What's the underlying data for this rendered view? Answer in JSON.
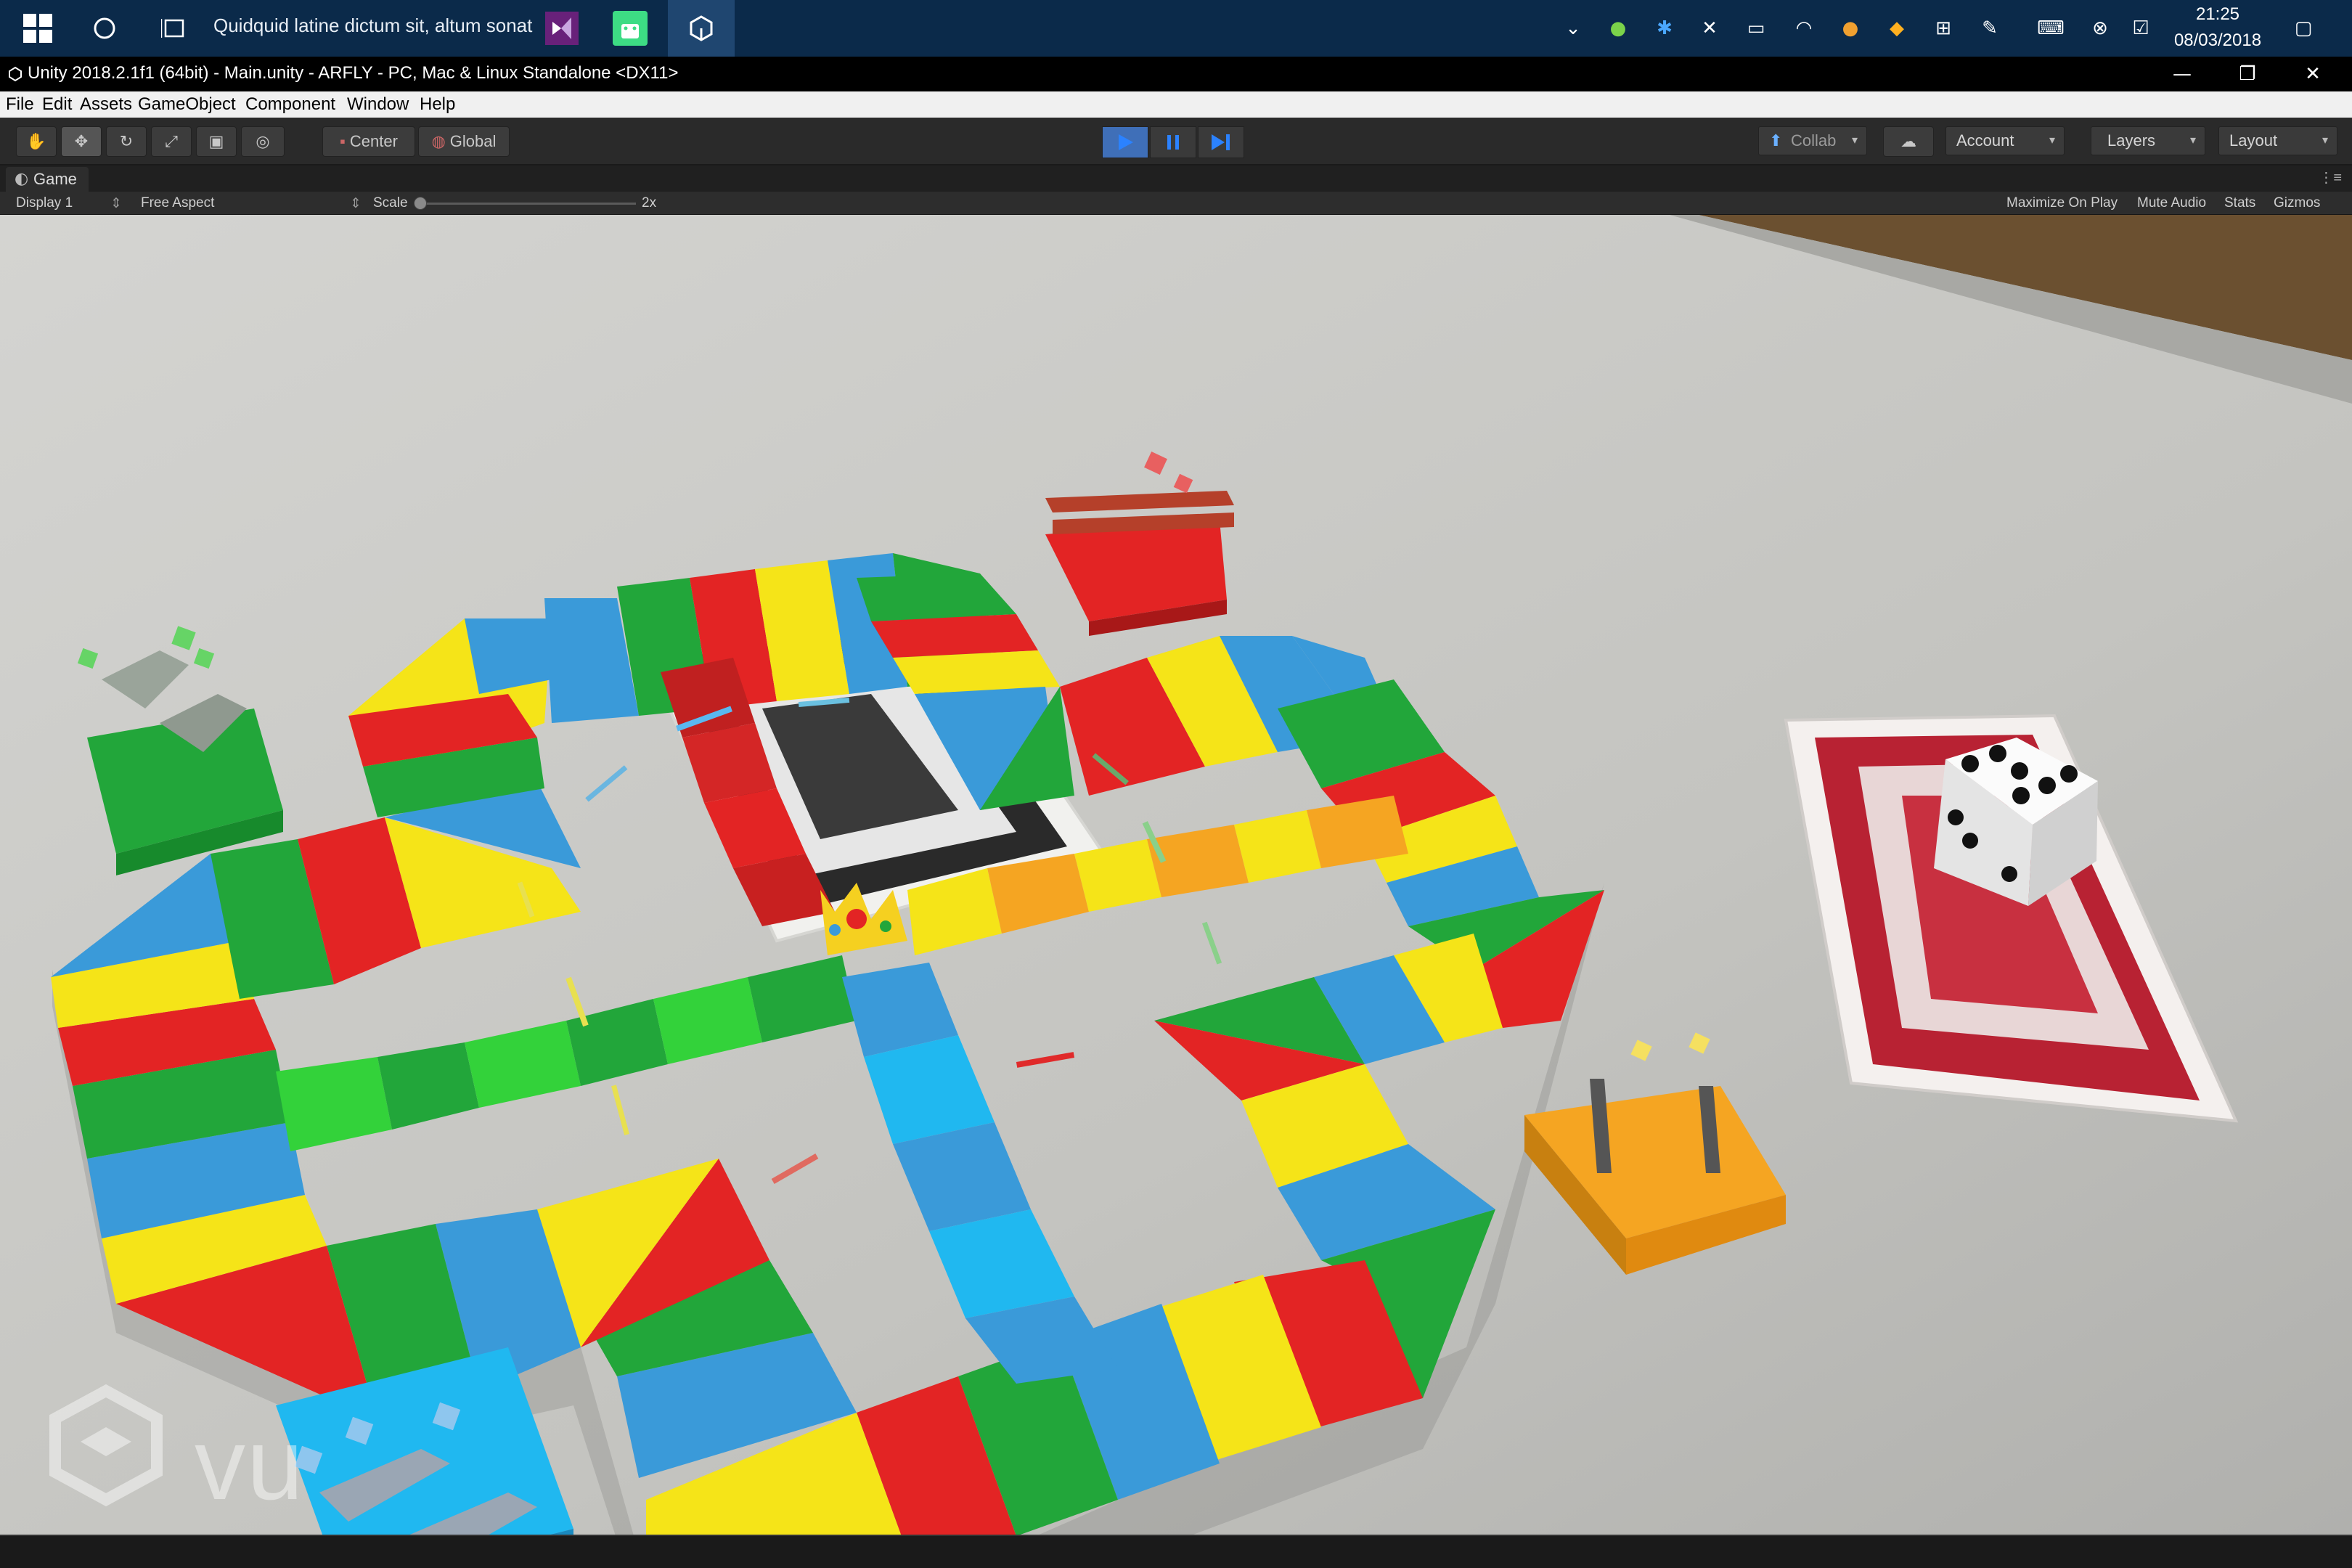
{
  "taskbar": {
    "task_title": "Quidquid latine dictum sit, altum sonat",
    "clock_time": "21:25",
    "clock_date": "08/03/2018",
    "apps": [
      "start-icon",
      "cortana-icon",
      "task-view-icon",
      "visual-studio-icon",
      "android-studio-icon",
      "unity-icon"
    ],
    "tray_icons": [
      "chevron-up-icon",
      "wechat-icon",
      "bluetooth-icon",
      "mute-icon",
      "battery-icon",
      "wifi-icon",
      "browser-icon",
      "shield-icon",
      "plus-icon",
      "pen-icon",
      "keyboard-icon",
      "close-circle-icon",
      "check-square-icon",
      "notification-icon"
    ]
  },
  "window": {
    "title": "Unity 2018.2.1f1 (64bit) - Main.unity - ARFLY - PC, Mac & Linux Standalone <DX11>",
    "minimize": "—",
    "maximize": "❐",
    "close": "✕"
  },
  "menu": {
    "file": "File",
    "edit": "Edit",
    "assets": "Assets",
    "gameobject": "GameObject",
    "component": "Component",
    "window": "Window",
    "help": "Help"
  },
  "toolbar": {
    "center": "Center",
    "global": "Global",
    "collab": "Collab",
    "account": "Account",
    "layers": "Layers",
    "layout": "Layout",
    "play_state": "playing"
  },
  "game_view": {
    "tab_label": "Game",
    "display": "Display 1",
    "aspect": "Free Aspect",
    "scale_label": "Scale",
    "scale_value": "2x",
    "maximize_on_play": "Maximize On Play",
    "mute_audio": "Mute Audio",
    "stats": "Stats",
    "gizmos": "Gizmos",
    "watermark": "vu"
  },
  "colors": {
    "red": "#e32424",
    "green": "#22a63a",
    "blue": "#3a9ad9",
    "yellow": "#f5e418",
    "orange": "#f5a522",
    "light_green": "#33d23a",
    "cyan": "#20b8f0"
  }
}
